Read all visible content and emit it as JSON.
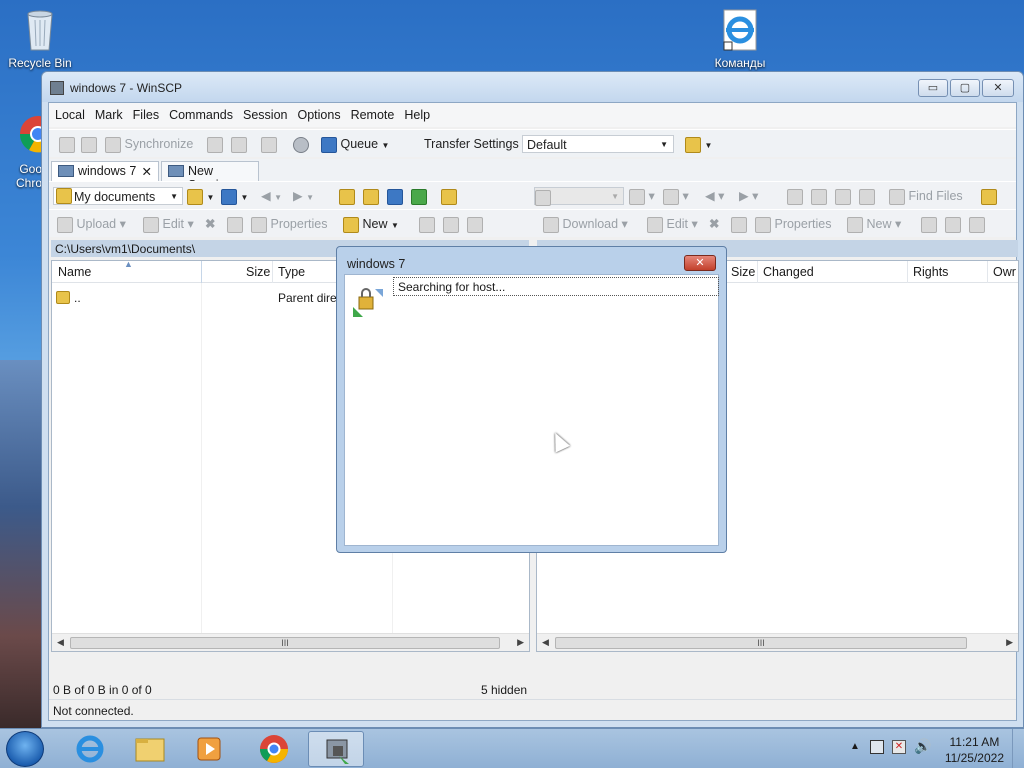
{
  "desktop": {
    "icons": [
      {
        "name": "recycle-bin",
        "label": "Recycle Bin"
      },
      {
        "name": "chrome",
        "label": "Goo\nChro"
      },
      {
        "name": "ie-commands",
        "label": "Команды"
      }
    ]
  },
  "window": {
    "title": "windows 7 - WinSCP",
    "controls": {
      "minimize": "▭",
      "maximize": "▢",
      "close": "✕"
    }
  },
  "menu": [
    "Local",
    "Mark",
    "Files",
    "Commands",
    "Session",
    "Options",
    "Remote",
    "Help"
  ],
  "toolbar1": {
    "synchronize": "Synchronize",
    "queue": "Queue",
    "transfer_settings_label": "Transfer Settings",
    "transfer_settings_value": "Default"
  },
  "tabs": [
    {
      "label": "windows 7",
      "close": "✕"
    },
    {
      "label": "New Session"
    }
  ],
  "left_panel": {
    "location": "My documents",
    "toolbar": {
      "upload": "Upload",
      "edit": "Edit",
      "properties": "Properties",
      "new": "New"
    },
    "path": "C:\\Users\\vm1\\Documents\\",
    "columns": [
      "Name",
      "Size",
      "Type"
    ],
    "rows": [
      {
        "name": "..",
        "size": "",
        "type": "Parent directory"
      }
    ],
    "status_left": "0 B of 0 B in 0 of 0",
    "status_right": "5 hidden"
  },
  "right_panel": {
    "toolbar": {
      "find_files": "Find Files",
      "download": "Download",
      "edit": "Edit",
      "properties": "Properties",
      "new": "New"
    },
    "columns": [
      "Size",
      "Changed",
      "Rights",
      "Owr"
    ]
  },
  "status_bar": "Not connected.",
  "dialog": {
    "title": "windows 7",
    "close": "✕",
    "message": "Searching for host..."
  },
  "taskbar": {
    "apps": [
      "internet-explorer",
      "file-explorer",
      "media-player",
      "chrome",
      "winscp"
    ],
    "time": "11:21 AM",
    "date": "11/25/2022"
  },
  "colors": {
    "titlebar": "#c3d7ee",
    "taskbar": "#8fb0d4",
    "dialog_frame": "#b9d0ea",
    "close_button": "#c2412c"
  }
}
